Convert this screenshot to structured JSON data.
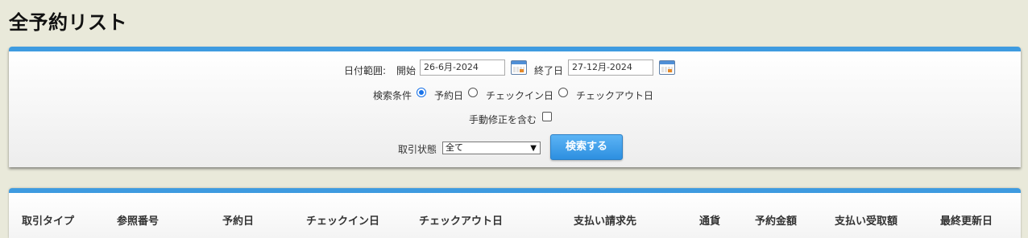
{
  "page": {
    "title": "全予約リスト"
  },
  "search": {
    "date_range_label": "日付範囲:",
    "start_label": "開始",
    "start_value": "26-6月-2024",
    "end_label": "終了日",
    "end_value": "27-12月-2024",
    "criteria_label": "検索条件",
    "criteria_options": [
      "予約日",
      "チェックイン日",
      "チェックアウト日"
    ],
    "criteria_selected": "予約日",
    "manual_edit_label": "手動修正を含む",
    "manual_edit_checked": false,
    "status_label": "取引状態",
    "status_value": "全て",
    "search_button": "検索する",
    "accent_color": "#3e9be0"
  },
  "table": {
    "columns": [
      "取引タイプ",
      "参照番号",
      "予約日",
      "チェックイン日",
      "チェックアウト日",
      "支払い請求先",
      "通貨",
      "予約金額",
      "支払い受取額",
      "最終更新日"
    ]
  },
  "icons": {
    "calendar": "calendar-icon",
    "dropdown": "chevron-down-icon"
  }
}
